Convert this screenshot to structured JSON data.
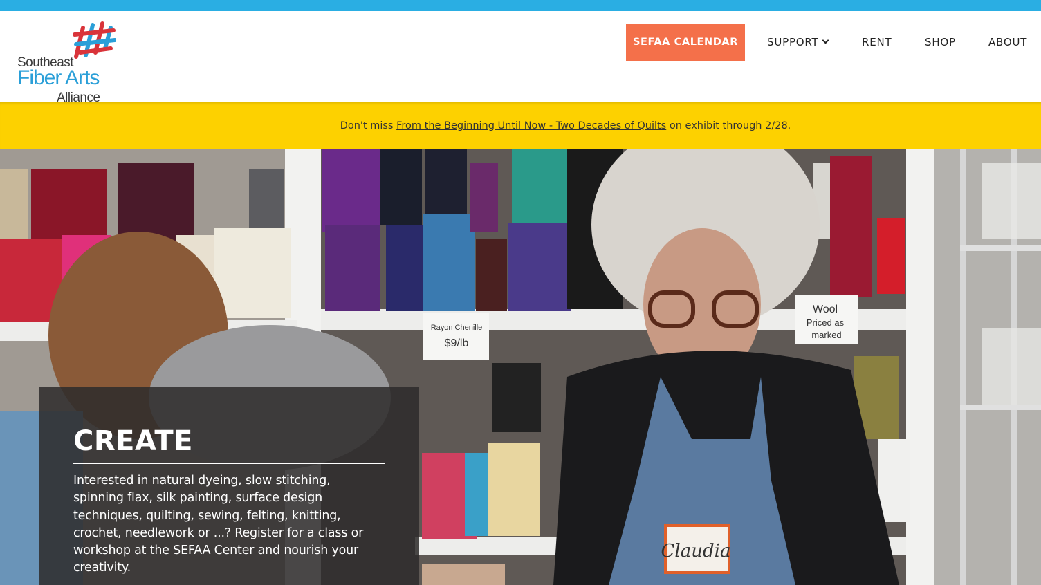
{
  "colors": {
    "top_strip": "#2aaee3",
    "cta_background": "#f4704a",
    "banner_background": "#fdd100",
    "logo_blue": "#2a9fd8",
    "logo_red": "#d9343a"
  },
  "logo": {
    "line1": "Southeast",
    "line2": "Fiber Arts",
    "line3": "Alliance",
    "icon": "woven-lines-icon"
  },
  "nav": {
    "cta_label": "SEFAA CALENDAR",
    "support_label": "SUPPORT",
    "support_icon": "chevron-down-icon",
    "rent_label": "RENT",
    "shop_label": "SHOP",
    "about_label": "ABOUT"
  },
  "banner": {
    "prefix": "Don't miss",
    "link_text": "From the Beginning Until Now - Two Decades of Quilts",
    "suffix": "on exhibit through 2/28."
  },
  "hero": {
    "photo_sign_1": {
      "line1": "Rayon Chenille",
      "line2": "$9/lb"
    },
    "photo_sign_2": {
      "line1": "Wool",
      "line2": "Priced as",
      "line3": "marked"
    },
    "name_tag": "Claudia",
    "card_title": "CREATE",
    "card_text": "Interested in natural dyeing, slow stitching, spinning flax, silk painting, surface design techniques, quilting, sewing, felting, knitting, crochet, needlework or ...? Register for a class or workshop at the SEFAA Center and nourish your creativity."
  }
}
